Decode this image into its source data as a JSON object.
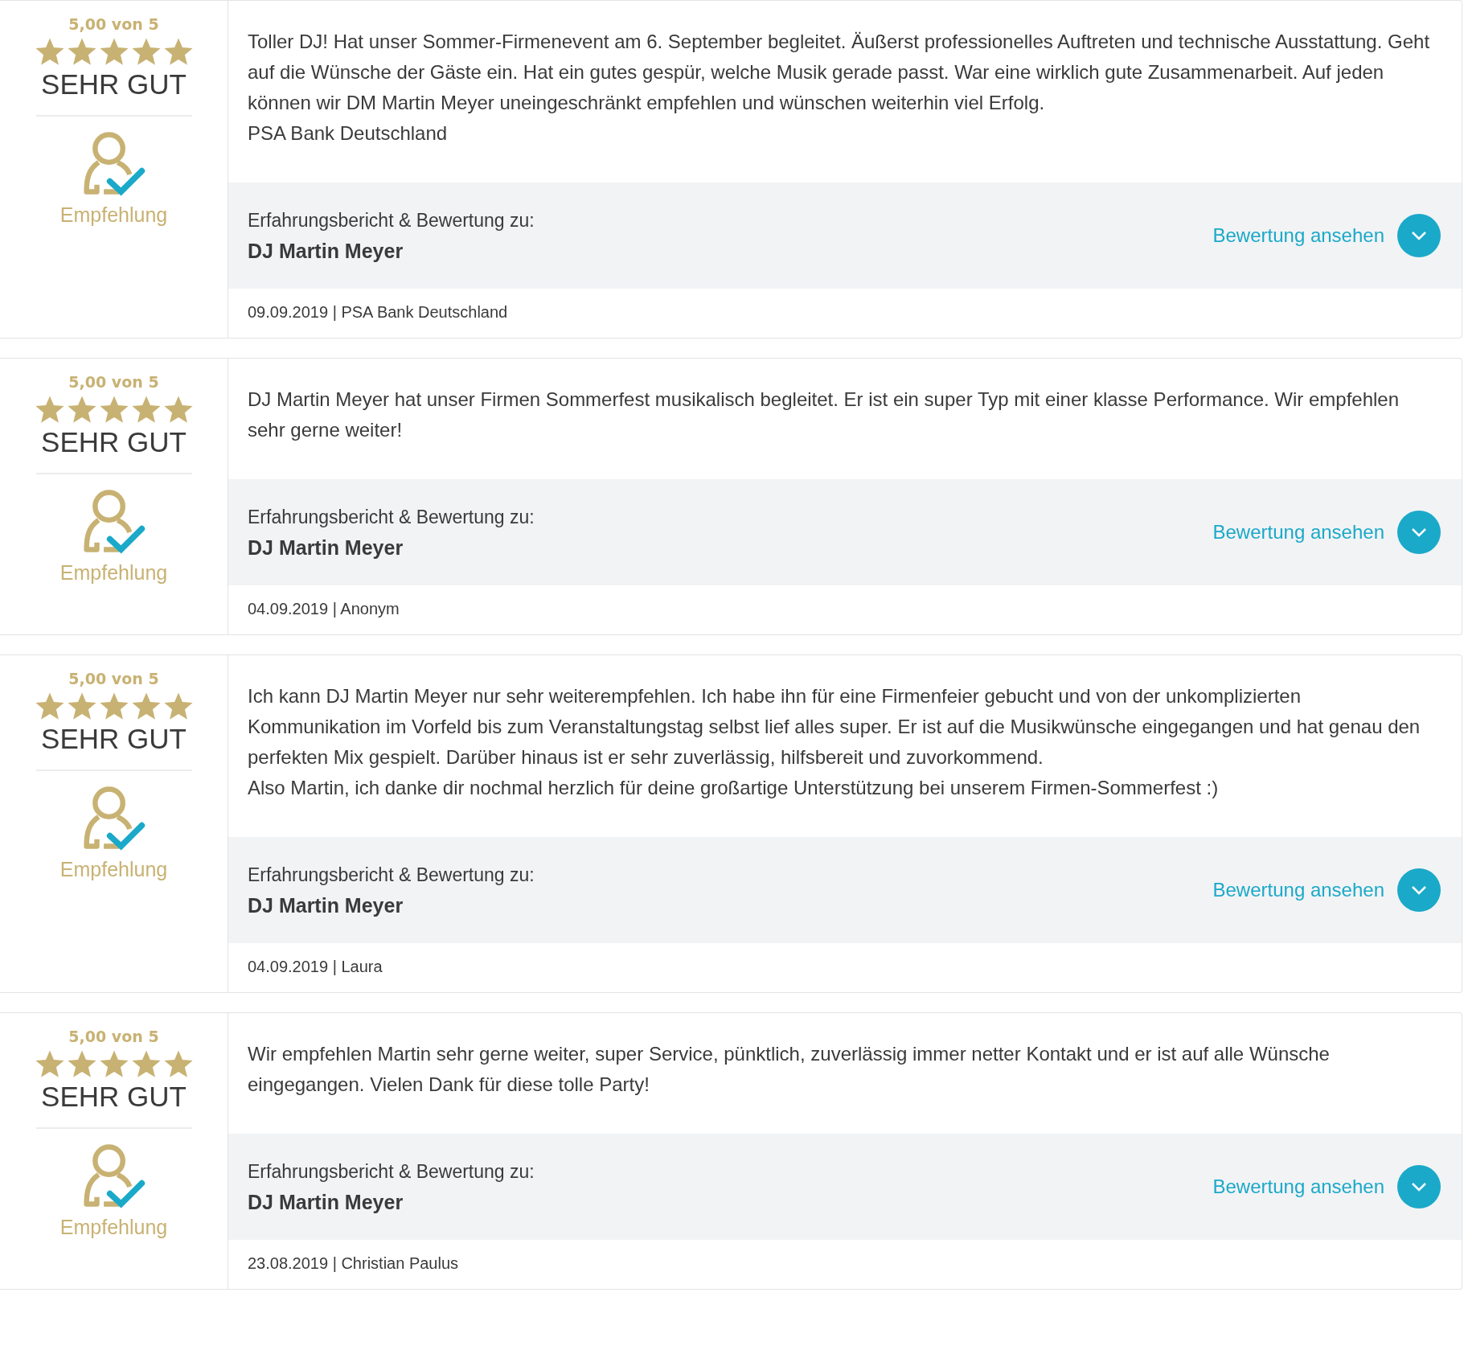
{
  "reviews": [
    {
      "score": "5,00 von 5",
      "stars": 5,
      "grade": "SEHR GUT",
      "badge": "Empfehlung",
      "text": "Toller DJ! Hat unser Sommer-Firmenevent am 6. September begleitet. Äußerst professionelles Auftreten und technische Ausstattung. Geht auf die Wünsche der Gäste ein. Hat ein gutes gespür, welche Musik gerade passt. War eine wirklich gute Zusammenarbeit. Auf jeden können wir DM Martin Meyer uneingeschränkt empfehlen und wünschen weiterhin viel Erfolg.\nPSA Bank Deutschland",
      "subject_label": "Erfahrungsbericht & Bewertung zu:",
      "subject_name": "DJ Martin Meyer",
      "link": "Bewertung ansehen",
      "footer": "09.09.2019 | PSA Bank Deutschland"
    },
    {
      "score": "5,00 von 5",
      "stars": 5,
      "grade": "SEHR GUT",
      "badge": "Empfehlung",
      "text": "DJ Martin Meyer hat unser Firmen Sommerfest musikalisch begleitet. Er ist ein super Typ mit einer klasse Performance. Wir empfehlen sehr gerne weiter!",
      "subject_label": "Erfahrungsbericht & Bewertung zu:",
      "subject_name": "DJ Martin Meyer",
      "link": "Bewertung ansehen",
      "footer": "04.09.2019 | Anonym"
    },
    {
      "score": "5,00 von 5",
      "stars": 5,
      "grade": "SEHR GUT",
      "badge": "Empfehlung",
      "text": "Ich kann DJ Martin Meyer nur sehr weiterempfehlen. Ich habe ihn für eine Firmenfeier gebucht und von der unkomplizierten Kommunikation im Vorfeld bis zum Veranstaltungstag selbst lief alles super. Er ist auf die Musikwünsche eingegangen und hat genau den perfekten Mix gespielt. Darüber hinaus ist er sehr zuverlässig, hilfsbereit und zuvorkommend.\nAlso Martin, ich danke dir nochmal herzlich für deine großartige Unterstützung bei unserem Firmen-Sommerfest :)",
      "subject_label": "Erfahrungsbericht & Bewertung zu:",
      "subject_name": "DJ Martin Meyer",
      "link": "Bewertung ansehen",
      "footer": "04.09.2019 | Laura"
    },
    {
      "score": "5,00 von 5",
      "stars": 5,
      "grade": "SEHR GUT",
      "badge": "Empfehlung",
      "text": "Wir empfehlen Martin sehr gerne weiter, super Service, pünktlich, zuverlässig immer netter Kontakt und er ist auf alle Wünsche eingegangen. Vielen Dank für diese tolle Party!",
      "subject_label": "Erfahrungsbericht & Bewertung zu:",
      "subject_name": "DJ Martin Meyer",
      "link": "Bewertung ansehen",
      "footer": "23.08.2019 | Christian Paulus"
    }
  ]
}
